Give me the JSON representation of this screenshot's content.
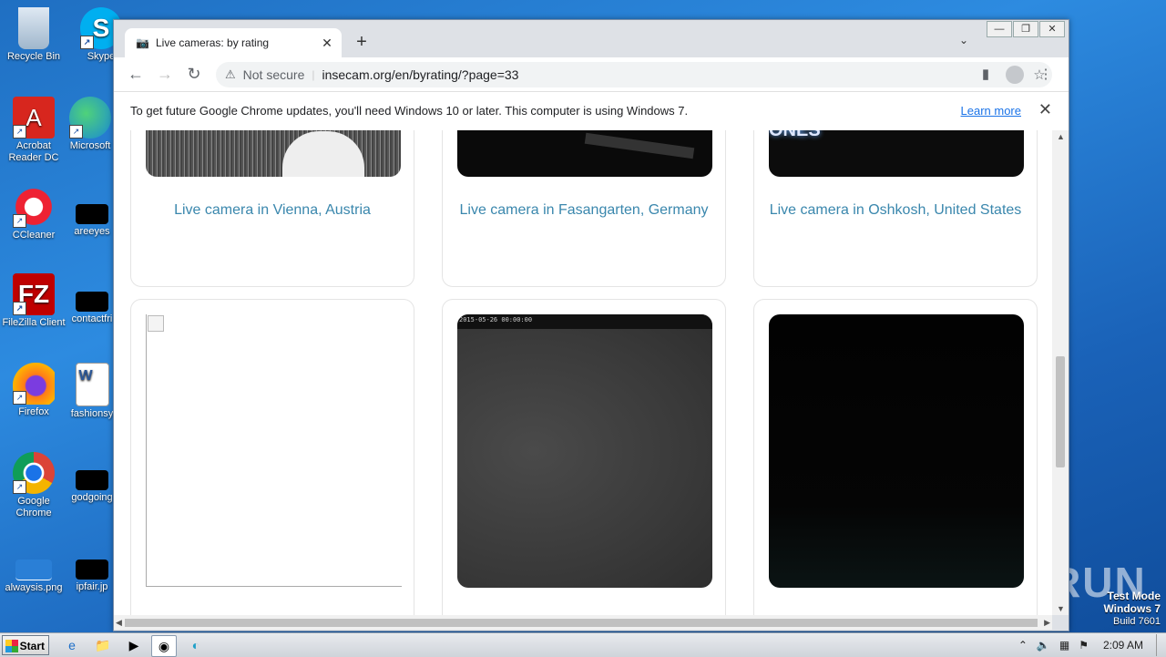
{
  "desktop": {
    "icons": [
      {
        "label": "Recycle Bin"
      },
      {
        "label": "Skype"
      },
      {
        "label": "Acrobat Reader DC"
      },
      {
        "label": "Microsoft"
      },
      {
        "label": "CCleaner"
      },
      {
        "label": "areeyes"
      },
      {
        "label": "FileZilla Client"
      },
      {
        "label": "contactfri"
      },
      {
        "label": "Firefox"
      },
      {
        "label": "fashionsy"
      },
      {
        "label": "Google Chrome"
      },
      {
        "label": "godgoing"
      },
      {
        "label": "alwaysis.png"
      },
      {
        "label": "ipfair.jp"
      }
    ]
  },
  "browser": {
    "tab_title": "Live cameras: by rating",
    "not_secure": "Not secure",
    "url": "insecam.org/en/byrating/?page=33",
    "infobar": {
      "message": "To get future Google Chrome updates, you'll need Windows 10 or later. This computer is using Windows 7.",
      "link": "Learn more"
    }
  },
  "cameras": [
    {
      "caption": "Live camera in Vienna, Austria"
    },
    {
      "caption": "Live camera in Fasangarten, Germany"
    },
    {
      "caption": "Live camera in Oshkosh, United States"
    },
    {
      "caption": ""
    },
    {
      "caption": ""
    },
    {
      "caption": ""
    }
  ],
  "cam_overlay": {
    "oshkosh_sign": "ONES",
    "row2_timestamp": "2015-05-26 00:00:00"
  },
  "taskbar": {
    "start_label": "Start",
    "clock": "2:09 AM"
  },
  "watermark": {
    "test_mode": "Test Mode",
    "os": "Windows 7",
    "build": "Build 7601",
    "brand": "ANY RUN"
  }
}
